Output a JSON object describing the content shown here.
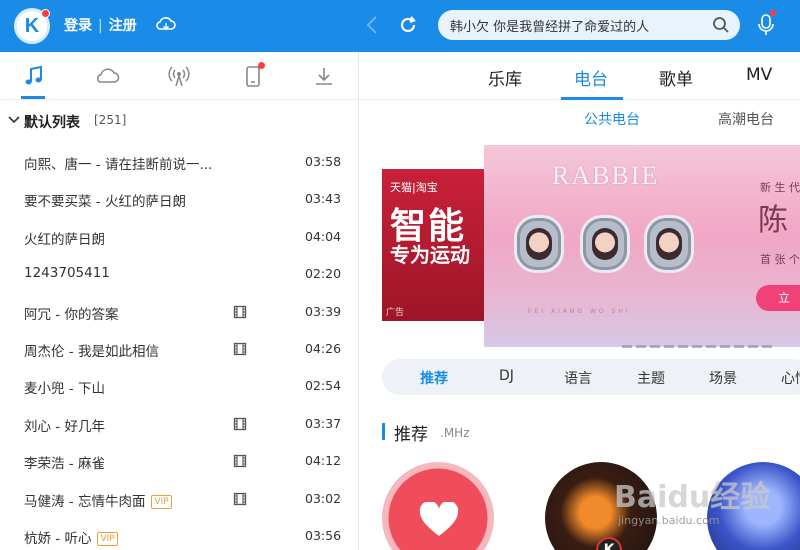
{
  "header": {
    "login": "登录",
    "separator": "|",
    "register": "注册",
    "search_value": "韩小欠 你是我曾经拼了命爱过的人"
  },
  "colors": {
    "accent": "#1a8ce8",
    "notification": "#ff3b3b",
    "vip": "#e8a13a"
  },
  "left_tabs": [
    {
      "icon": "music-note-icon",
      "active": true
    },
    {
      "icon": "cloud-icon"
    },
    {
      "icon": "radio-tower-icon"
    },
    {
      "icon": "phone-icon",
      "badge": true
    },
    {
      "icon": "download-icon"
    }
  ],
  "playlist": {
    "name": "默认列表",
    "count": "[251]",
    "songs": [
      {
        "title": "向熙、唐一 - 请在挂断前说一...",
        "duration": "03:58"
      },
      {
        "title": "要不要买菜 - 火红的萨日朗",
        "duration": "03:43"
      },
      {
        "title": "火红的萨日朗",
        "duration": "04:04"
      },
      {
        "title": "1243705411",
        "duration": "02:20"
      },
      {
        "title": "阿冗 - 你的答案",
        "duration": "03:39",
        "mv": true
      },
      {
        "title": "周杰伦 - 我是如此相信",
        "duration": "04:26",
        "mv": true
      },
      {
        "title": "麦小兜 - 下山",
        "duration": "02:54"
      },
      {
        "title": "刘心 - 好几年",
        "duration": "03:37",
        "mv": true
      },
      {
        "title": "李荣浩 - 麻雀",
        "duration": "04:12",
        "mv": true
      },
      {
        "title": "马健涛 - 忘情牛肉面",
        "duration": "03:02",
        "mv": true,
        "vip": "VIP"
      },
      {
        "title": "杭娇 - 听心",
        "duration": "03:56",
        "vip": "VIP"
      }
    ]
  },
  "main_tabs": [
    "乐库",
    "电台",
    "歌单",
    "MV"
  ],
  "sub_tabs": [
    "公共电台",
    "高潮电台"
  ],
  "banner": {
    "left_top": "天猫|淘宝",
    "left_big": "智能",
    "left_mid": "专为运动",
    "left_tag": "广告",
    "brand": "RABBIE",
    "side_small": "新 生 代",
    "side_big": "陈",
    "side_small2": "首 张 个",
    "cta": "立",
    "caption": "FEI XIANG WO SHI"
  },
  "categories": [
    "推荐",
    "DJ",
    "语言",
    "主题",
    "场景",
    "心情"
  ],
  "recommend": {
    "title": "推荐",
    "sub": ".MHz"
  },
  "watermark": {
    "main": "Baidu经验",
    "sub": "jingyan.baidu.com"
  }
}
